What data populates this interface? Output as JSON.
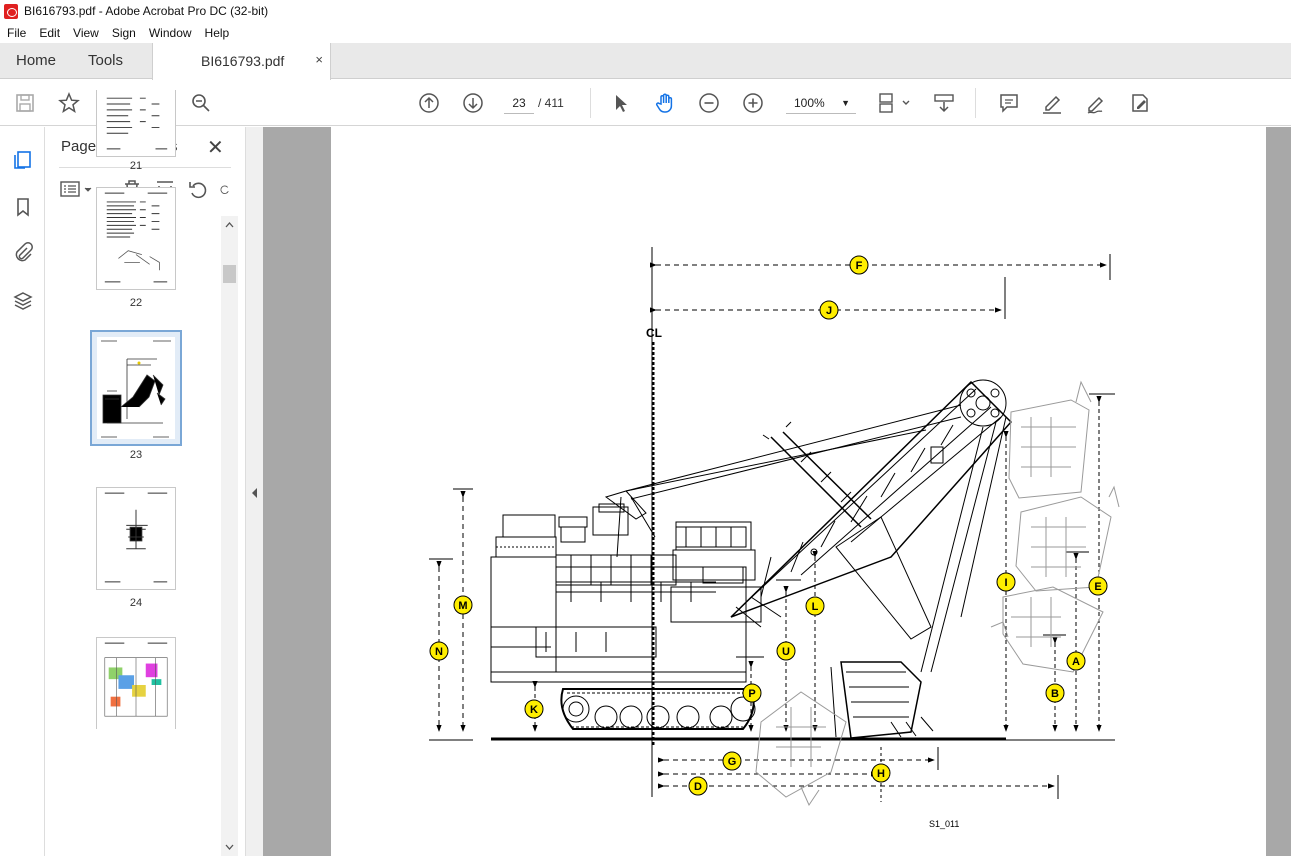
{
  "window": {
    "title": "BI616793.pdf - Adobe Acrobat Pro DC (32-bit)"
  },
  "menu": [
    "File",
    "Edit",
    "View",
    "Sign",
    "Window",
    "Help"
  ],
  "tabs": {
    "home": "Home",
    "tools": "Tools",
    "document": "BI616793.pdf",
    "close": "×"
  },
  "toolbar": {
    "current_page": "23",
    "total_pages": "/ 411",
    "zoom": "100%",
    "icons": [
      "save-icon",
      "star-icon",
      "upload-icon",
      "print-icon",
      "search-icon",
      "page-up-icon",
      "page-down-icon",
      "select-arrow-icon",
      "hand-icon",
      "zoom-out-icon",
      "zoom-in-icon",
      "fit-page-icon",
      "scroll-mode-icon",
      "comment-icon",
      "highlight-icon",
      "sign-icon",
      "edit-pdf-icon"
    ]
  },
  "panel": {
    "title": "Page Thumbnails",
    "close": "✕",
    "thumbnails": [
      {
        "label": "21"
      },
      {
        "label": "22"
      },
      {
        "label": "23",
        "selected": true
      },
      {
        "label": "24"
      },
      {
        "label": ""
      }
    ]
  },
  "drawing": {
    "code": "S1_011",
    "centerline": "CL",
    "dimension_labels": [
      "F",
      "J",
      "E",
      "I",
      "A",
      "B",
      "L",
      "U",
      "P",
      "K",
      "M",
      "N",
      "G",
      "H",
      "D"
    ]
  },
  "colors": {
    "accent": "#1473e6",
    "label_fill": "#ffee00",
    "viewer_bg": "#a8a8a8"
  }
}
